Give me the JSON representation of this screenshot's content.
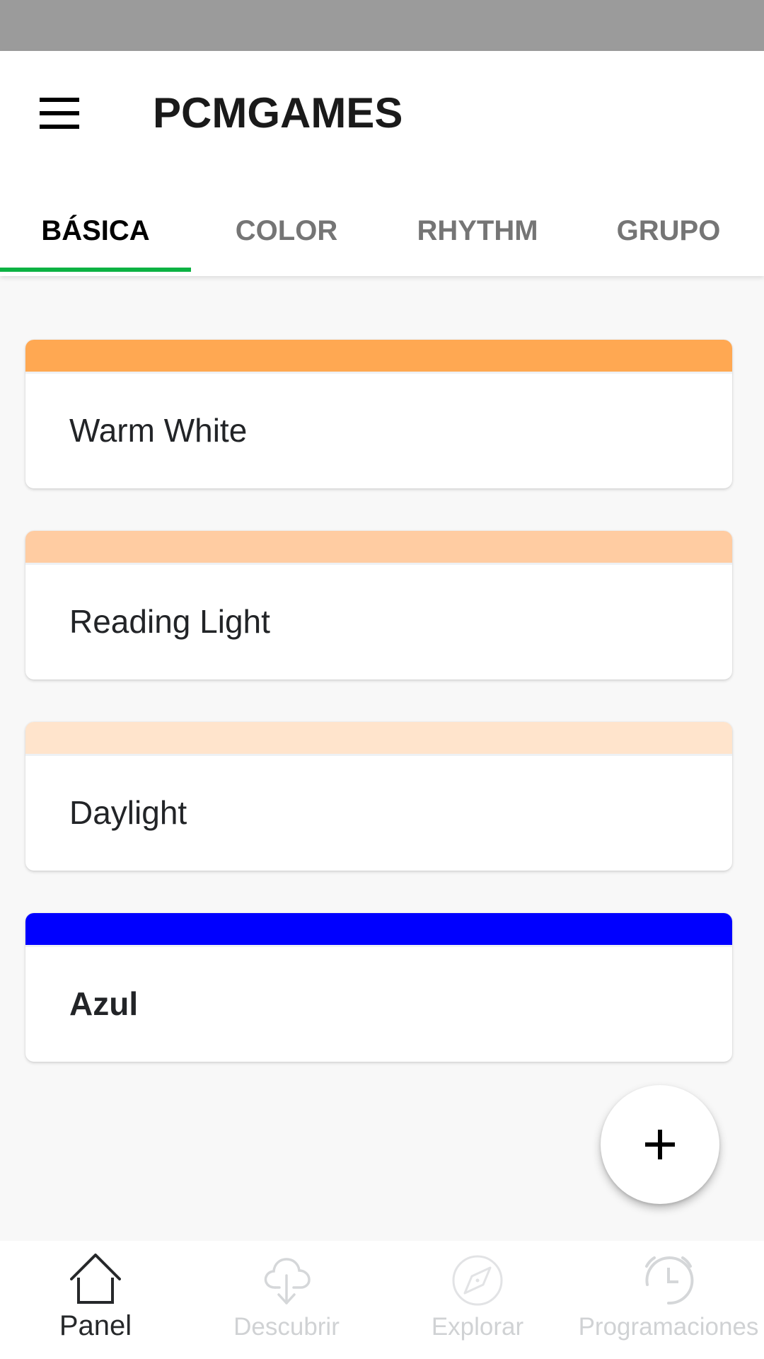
{
  "app_bar": {
    "title": "PCMGAMES",
    "menu_icon": "hamburger-menu-icon"
  },
  "tabs": [
    {
      "label": "BÁSICA",
      "active": true
    },
    {
      "label": "COLOR",
      "active": false
    },
    {
      "label": "RHYTHM",
      "active": false
    },
    {
      "label": "GRUPO",
      "active": false
    }
  ],
  "accent_color": "#0cb243",
  "presets": [
    {
      "label": "Warm White",
      "color": "#ffa852",
      "bold": false
    },
    {
      "label": "Reading Light",
      "color": "#ffcca2",
      "bold": false
    },
    {
      "label": "Daylight",
      "color": "#ffe4cc",
      "bold": false
    },
    {
      "label": "Azul",
      "color": "#0000ff",
      "bold": true
    }
  ],
  "fab": {
    "icon": "plus-icon"
  },
  "bottom_nav": [
    {
      "label": "Panel",
      "icon": "home-icon",
      "active": true
    },
    {
      "label": "Descubrir",
      "icon": "cloud-download-icon",
      "active": false
    },
    {
      "label": "Explorar",
      "icon": "compass-icon",
      "active": false
    },
    {
      "label": "Programaciones",
      "icon": "alarm-clock-icon",
      "active": false
    }
  ]
}
